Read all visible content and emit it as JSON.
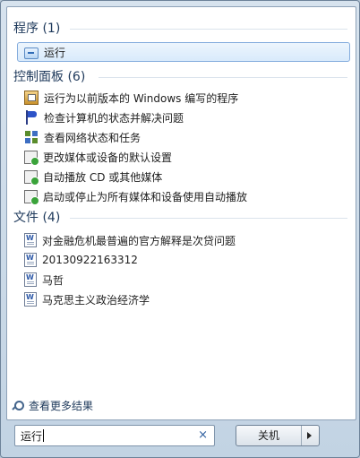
{
  "groups": [
    {
      "header": "程序 (1)",
      "items": [
        {
          "label": "运行",
          "icon": "run-icon"
        }
      ]
    },
    {
      "header": "控制面板 (6)",
      "items": [
        {
          "label": "运行为以前版本的 Windows 编写的程序",
          "icon": "compatibility-icon"
        },
        {
          "label": "检查计算机的状态并解决问题",
          "icon": "flag-icon"
        },
        {
          "label": "查看网络状态和任务",
          "icon": "network-icon"
        },
        {
          "label": "更改媒体或设备的默认设置",
          "icon": "autoplay-icon"
        },
        {
          "label": "自动播放 CD 或其他媒体",
          "icon": "autoplay-icon"
        },
        {
          "label": "启动或停止为所有媒体和设备使用自动播放",
          "icon": "autoplay-icon"
        }
      ]
    },
    {
      "header": "文件 (4)",
      "items": [
        {
          "label": "对金融危机最普遍的官方解释是次贷问题",
          "icon": "word-document-icon"
        },
        {
          "label": "20130922163312",
          "icon": "word-document-icon"
        },
        {
          "label": "马哲",
          "icon": "word-document-icon"
        },
        {
          "label": "马克思主义政治经济学",
          "icon": "word-document-icon"
        }
      ]
    }
  ],
  "see_more": "查看更多结果",
  "search": {
    "value": "运行",
    "clear_icon": "×"
  },
  "shutdown": {
    "label": "关机"
  },
  "colors": {
    "header": "#1e395b",
    "selection_border": "#84acdd"
  }
}
